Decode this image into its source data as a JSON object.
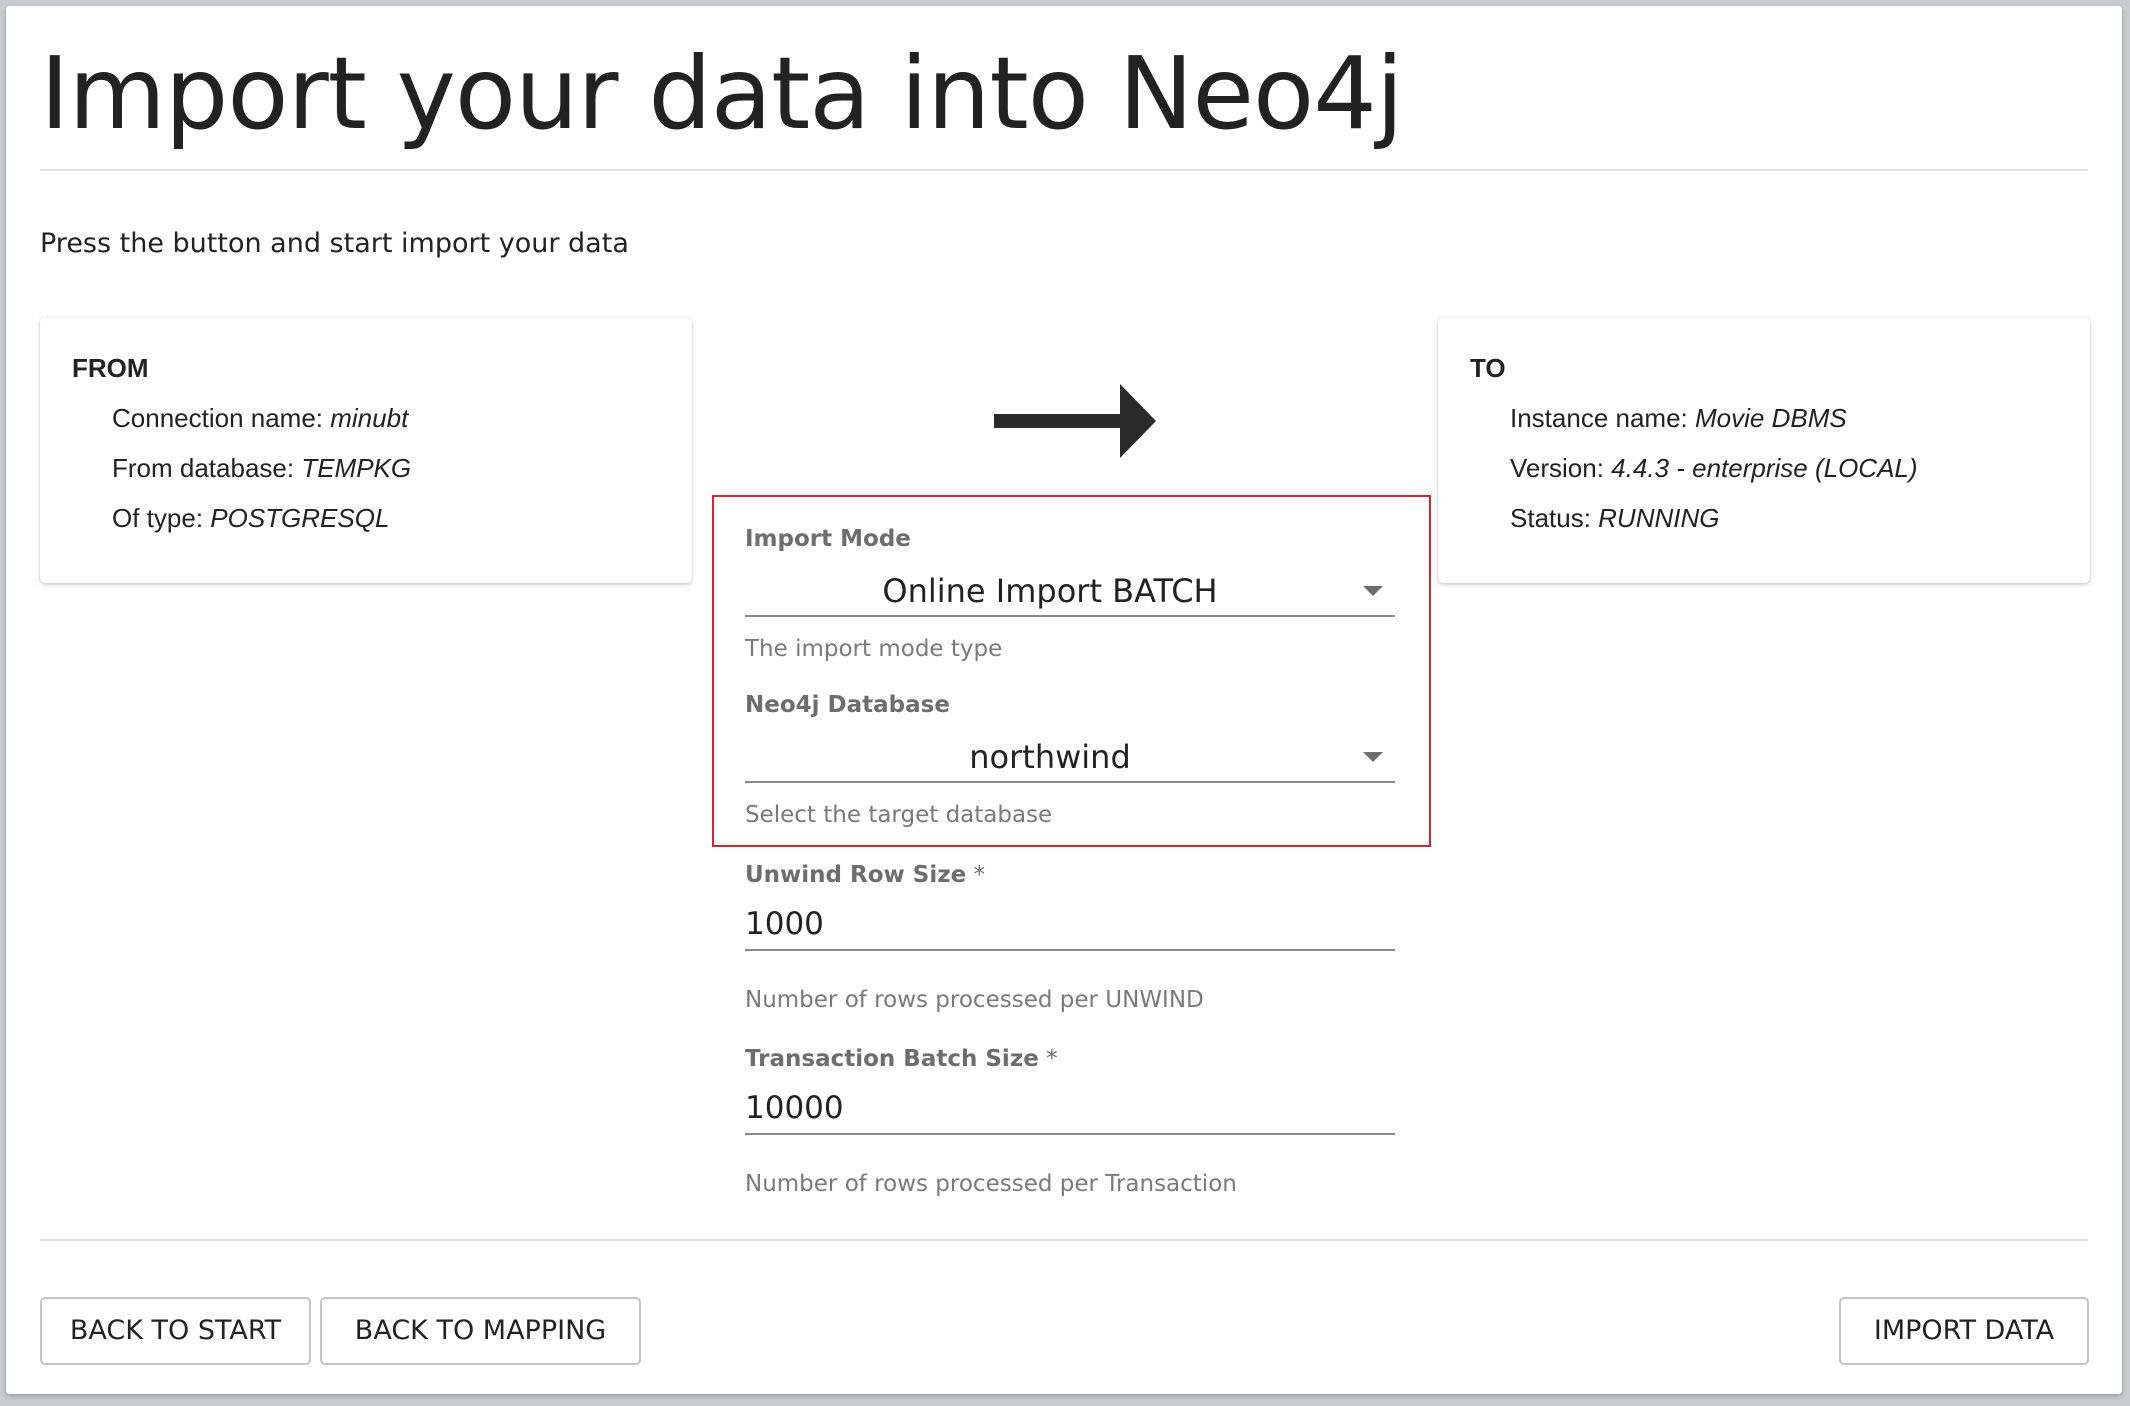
{
  "header": {
    "title": "Import your data into Neo4j",
    "subtitle": "Press the button and start import your data"
  },
  "from_card": {
    "title": "FROM",
    "connection_label": "Connection name: ",
    "connection_value": "minubt",
    "database_label": "From database: ",
    "database_value": "TEMPKG",
    "type_label": "Of type: ",
    "type_value": "POSTGRESQL"
  },
  "to_card": {
    "title": "TO",
    "instance_label": "Instance name: ",
    "instance_value": "Movie DBMS",
    "version_label": "Version: ",
    "version_value": "4.4.3 - enterprise (LOCAL)",
    "status_label": "Status: ",
    "status_value": "RUNNING"
  },
  "arrow_icon": "right-arrow-icon",
  "form": {
    "import_mode": {
      "label": "Import Mode",
      "value": "Online Import BATCH",
      "helper": "The import mode type"
    },
    "neo4j_database": {
      "label": "Neo4j Database",
      "value": "northwind",
      "helper": "Select the target database"
    },
    "unwind_row_size": {
      "label": "Unwind Row Size",
      "required_mark": " *",
      "value": "1000",
      "helper": "Number of rows processed per UNWIND"
    },
    "transaction_batch_size": {
      "label": "Transaction Batch Size",
      "required_mark": " *",
      "value": "10000",
      "helper": "Number of rows processed per Transaction"
    }
  },
  "actions": {
    "back_to_start": "BACK TO START",
    "back_to_mapping": "BACK TO MAPPING",
    "import_data": "IMPORT DATA"
  },
  "colors": {
    "highlight_border": "#d6262d",
    "text_primary": "#222222",
    "text_secondary": "#6d6d6d"
  }
}
